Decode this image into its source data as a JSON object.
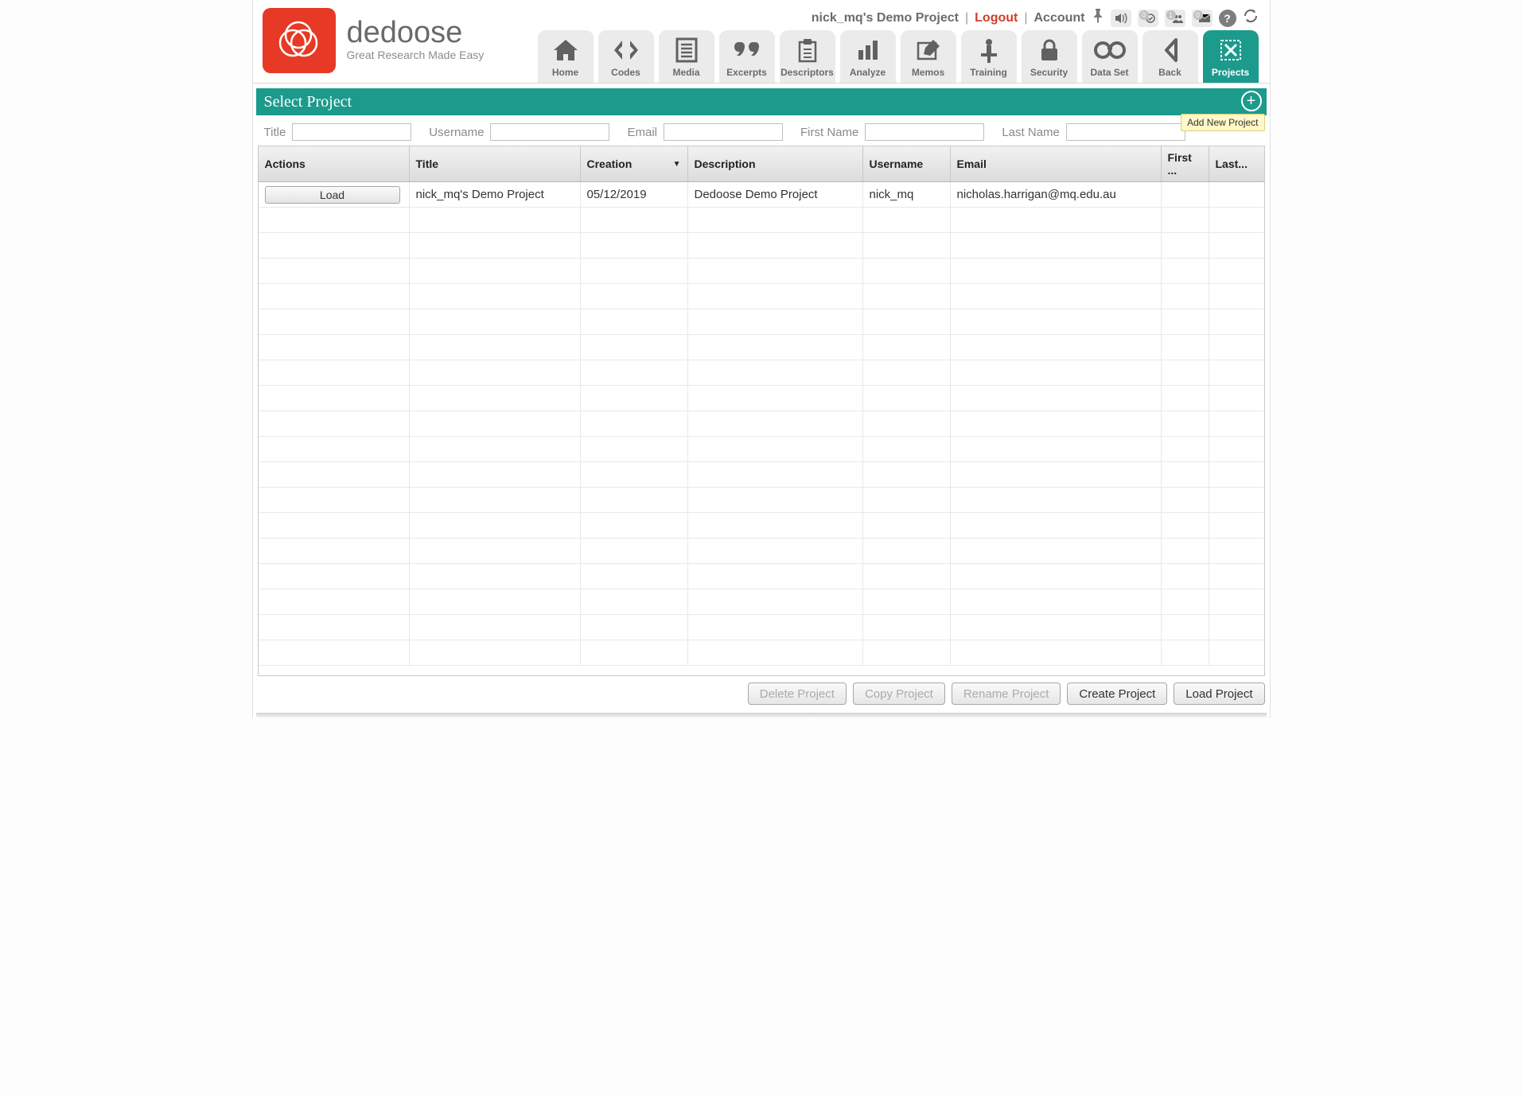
{
  "brand": {
    "name": "dedoose",
    "tagline": "Great Research Made Easy"
  },
  "header": {
    "project_name": "nick_mq's Demo Project",
    "logout": "Logout",
    "account": "Account",
    "badges": {
      "tasks": "0",
      "users": "1",
      "mail": "0"
    }
  },
  "nav": [
    {
      "id": "home",
      "label": "Home"
    },
    {
      "id": "codes",
      "label": "Codes"
    },
    {
      "id": "media",
      "label": "Media"
    },
    {
      "id": "excerpts",
      "label": "Excerpts"
    },
    {
      "id": "descriptors",
      "label": "Descriptors"
    },
    {
      "id": "analyze",
      "label": "Analyze"
    },
    {
      "id": "memos",
      "label": "Memos"
    },
    {
      "id": "training",
      "label": "Training"
    },
    {
      "id": "security",
      "label": "Security"
    },
    {
      "id": "dataset",
      "label": "Data Set"
    },
    {
      "id": "back",
      "label": "Back"
    },
    {
      "id": "projects",
      "label": "Projects",
      "active": true
    }
  ],
  "panel": {
    "title": "Select Project",
    "add_tooltip": "Add New Project"
  },
  "filters": {
    "title_label": "Title",
    "username_label": "Username",
    "email_label": "Email",
    "firstname_label": "First Name",
    "lastname_label": "Last Name"
  },
  "columns": {
    "actions": "Actions",
    "title": "Title",
    "creation": "Creation",
    "description": "Description",
    "username": "Username",
    "email": "Email",
    "first": "First ...",
    "last": "Last..."
  },
  "sort_indicator": "▼",
  "rows": [
    {
      "action_label": "Load",
      "title": "nick_mq's Demo Project",
      "creation": "05/12/2019",
      "description": "Dedoose Demo Project",
      "username": "nick_mq",
      "email": "nicholas.harrigan@mq.edu.au",
      "first": "",
      "last": ""
    }
  ],
  "empty_row_count": 18,
  "footer": {
    "delete": "Delete Project",
    "copy": "Copy Project",
    "rename": "Rename Project",
    "create": "Create Project",
    "load": "Load Project"
  }
}
